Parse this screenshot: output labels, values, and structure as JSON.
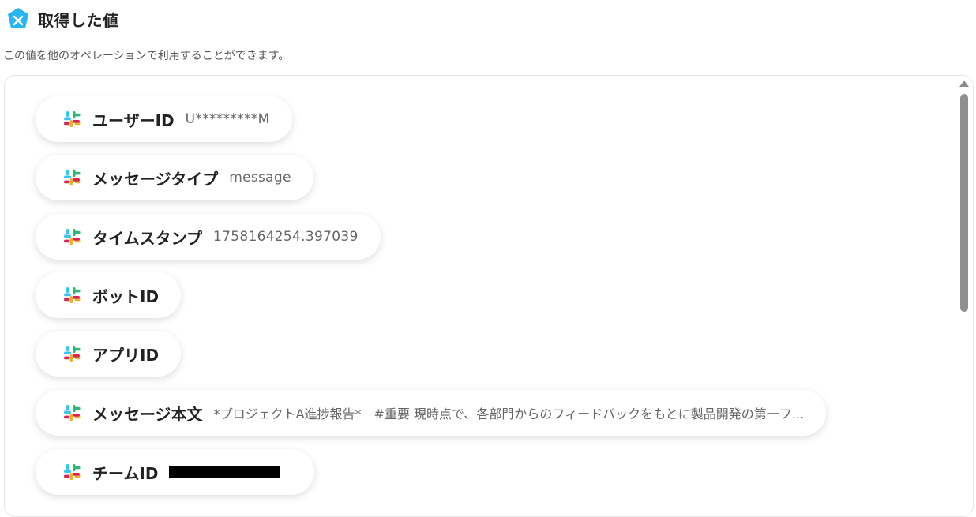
{
  "header": {
    "title": "取得した値",
    "logo_icon": "yoom-logo-icon",
    "logo_color": "#28b6f0"
  },
  "subtitle": "この値を他のオペレーションで利用することができます。",
  "items": [
    {
      "label": "ユーザーID",
      "value": "U*********M",
      "icon": "slack-icon"
    },
    {
      "label": "メッセージタイプ",
      "value": "message",
      "icon": "slack-icon"
    },
    {
      "label": "タイムスタンプ",
      "value": "1758164254.397039",
      "icon": "slack-icon"
    },
    {
      "label": "ボットID",
      "value": "",
      "icon": "slack-icon"
    },
    {
      "label": "アプリID",
      "value": "",
      "icon": "slack-icon"
    },
    {
      "label": "メッセージ本文",
      "value": "*プロジェクトA進捗報告*　#重要 現時点で、各部門からのフィードバックをもとに製品開発の第一フ...",
      "icon": "slack-icon"
    },
    {
      "label": "チームID",
      "value": "",
      "redacted": true,
      "icon": "slack-icon"
    }
  ],
  "colors": {
    "slack_blue": "#36c5f0",
    "slack_green": "#2eb67d",
    "slack_yellow": "#ecb22e",
    "slack_red": "#e01e5a"
  }
}
